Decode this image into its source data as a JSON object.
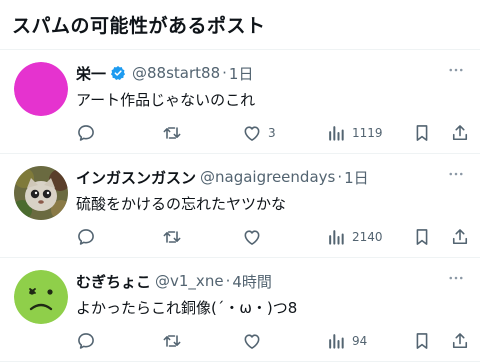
{
  "header": {
    "title": "スパムの可能性があるポスト"
  },
  "posts": [
    {
      "name": "栄一",
      "verified": true,
      "handle": "@88start88",
      "separator": "·",
      "time": "1日",
      "text": "アート作品じゃないのこれ",
      "avatar": "magenta-circle-avatar",
      "counts": {
        "reply": "",
        "retweet": "",
        "like": "3",
        "views": "1119"
      }
    },
    {
      "name": "インガスンガスン",
      "verified": false,
      "handle": "@nagaigreendays",
      "separator": "·",
      "time": "1日",
      "text": "硫酸をかけるの忘れたヤツかな",
      "avatar": "cat-face-avatar",
      "counts": {
        "reply": "",
        "retweet": "",
        "like": "",
        "views": "2140"
      }
    },
    {
      "name": "むぎちょこ",
      "verified": false,
      "handle": "@v1_xne",
      "separator": "·",
      "time": "4時間",
      "text": "よかったらこれ銅像(´・ω・)つ8",
      "avatar": "green-sad-face-avatar",
      "counts": {
        "reply": "",
        "retweet": "",
        "like": "",
        "views": "94"
      }
    }
  ],
  "icons": {
    "more": "more-icon",
    "reply": "reply-icon",
    "retweet": "retweet-icon",
    "like": "like-icon",
    "views": "views-icon",
    "bookmark": "bookmark-icon",
    "share": "share-icon",
    "verified": "verified-badge-icon"
  },
  "colors": {
    "text": "#0f1419",
    "muted": "#536471",
    "verified": "#1d9bf0",
    "border": "#eff3f4"
  }
}
